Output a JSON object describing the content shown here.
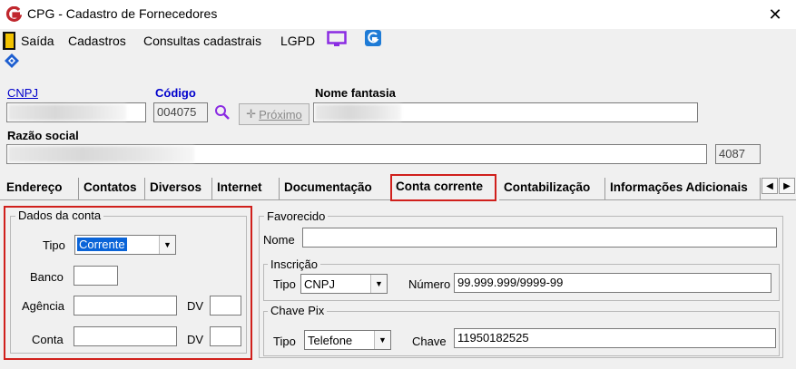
{
  "window": {
    "title": "CPG - Cadastro de Fornecedores",
    "close_glyph": "✕"
  },
  "menu": {
    "items": [
      "Saída",
      "Cadastros",
      "Consultas cadastrais",
      "LGPD"
    ]
  },
  "header": {
    "cnpj_label": "CNPJ",
    "codigo_label": "Código",
    "codigo_value": "004075",
    "proximo_label": "Próximo",
    "nome_fantasia_label": "Nome fantasia",
    "razao_social_label": "Razão social",
    "razao_code": "4087"
  },
  "tabs": [
    "Endereço",
    "Contatos",
    "Diversos",
    "Internet",
    "Documentação",
    "Conta corrente",
    "Contabilização",
    "Informações Adicionais"
  ],
  "active_tab": "Conta corrente",
  "dados_conta": {
    "title": "Dados da conta",
    "tipo_label": "Tipo",
    "tipo_value": "Corrente",
    "banco_label": "Banco",
    "agencia_label": "Agência",
    "conta_label": "Conta",
    "dv_label": "DV"
  },
  "favorecido": {
    "title": "Favorecido",
    "nome_label": "Nome",
    "inscricao_title": "Inscrição",
    "tipo_label": "Tipo",
    "tipo_value": "CNPJ",
    "numero_label": "Número",
    "numero_value": "99.999.999/9999-99"
  },
  "chave_pix": {
    "title": "Chave Pix",
    "tipo_label": "Tipo",
    "tipo_value": "Telefone",
    "chave_label": "Chave",
    "chave_value": "11950182525"
  },
  "colors": {
    "accent_blue": "#0000cc",
    "highlight": "#0a64d8",
    "outline_red": "#d0201c",
    "logo_red": "#c0272d"
  }
}
